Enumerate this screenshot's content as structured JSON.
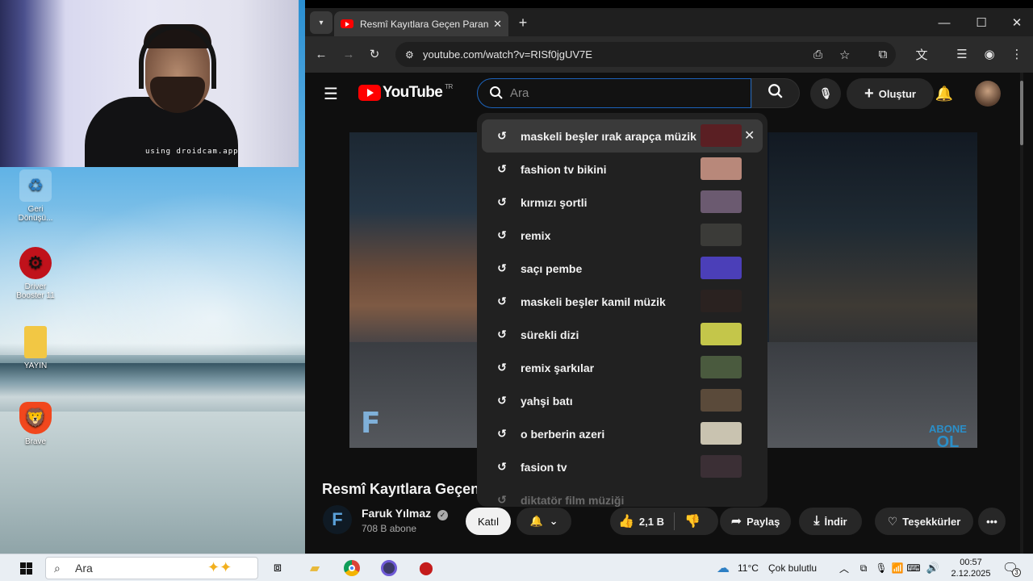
{
  "webcam": {
    "caption": "using droidcam.app"
  },
  "desktop_icons": [
    {
      "label": "Geri Dönüşü...",
      "icon": "recycle-bin-icon"
    },
    {
      "label": "Driver Booster 11",
      "icon": "driver-booster-icon"
    },
    {
      "label": "YAYIN",
      "icon": "folder-icon"
    },
    {
      "label": "Brave",
      "icon": "brave-icon"
    }
  ],
  "browser": {
    "tab_title": "Resmî Kayıtlara Geçen Paranorm",
    "url": "youtube.com/watch?v=RISf0jgUV7E"
  },
  "youtube": {
    "logo_text": "YouTube",
    "logo_region": "TR",
    "search_placeholder": "Ara",
    "create_label": "Oluştur",
    "suggestions": [
      {
        "text": "maskeli beşler ırak arapça müzik",
        "thumb": "#5a1f23"
      },
      {
        "text": "fashion tv bikini",
        "thumb": "#b8887a"
      },
      {
        "text": "kırmızı şortli",
        "thumb": "#6b5a70"
      },
      {
        "text": "remix",
        "thumb": "#3b3b38"
      },
      {
        "text": "saçı pembe",
        "thumb": "#4b3fb8"
      },
      {
        "text": "maskeli beşler kamil müzik",
        "thumb": "#2a2220"
      },
      {
        "text": "sürekli dizi",
        "thumb": "#c4c64a"
      },
      {
        "text": "remix şarkılar",
        "thumb": "#4a5a3e"
      },
      {
        "text": "yahşi batı",
        "thumb": "#5a4a3a"
      },
      {
        "text": "o berberin azeri",
        "thumb": "#c9c3b0"
      },
      {
        "text": "fasion tv",
        "thumb": "#3b2f35"
      },
      {
        "text": "diktatör film müziği",
        "thumb": "#212121"
      }
    ],
    "video_overlay_logo": "F",
    "video_overlay_cta": [
      "ABONE",
      "OL"
    ],
    "video_title": "Resmî Kayıtlara Geçen",
    "channel_name": "Faruk Yılmaz",
    "channel_avatar_letter": "F",
    "subscribers": "708 B abone",
    "join_label": "Katıl",
    "likes": "2,1 B",
    "share_label": "Paylaş",
    "download_label": "İndir",
    "thanks_label": "Teşekkürler"
  },
  "taskbar": {
    "search_placeholder": "Ara",
    "weather_temp": "11°C",
    "weather_text": "Çok bulutlu",
    "time": "00:57",
    "date": "2.12.2025",
    "notification_count": "3"
  }
}
